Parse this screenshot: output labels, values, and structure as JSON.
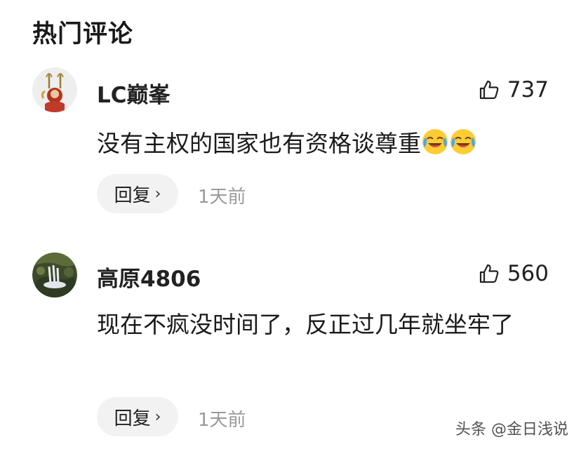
{
  "section": {
    "title": "热门评论"
  },
  "comments": [
    {
      "username": "LC巅峯",
      "likes": "737",
      "text": "没有主权的国家也有资格谈尊重",
      "emojis": [
        "laugh-cry-emoji",
        "laugh-cry-emoji"
      ],
      "reply_label": "回复",
      "time": "1天前"
    },
    {
      "username": "高原4806",
      "likes": "560",
      "text": "现在不疯没时间了，反正过几年就坐牢了",
      "reply_label": "回复",
      "time": "1天前"
    }
  ],
  "watermark": "头条 @金日浅说",
  "colors": {
    "secondary_text": "#9a9a9a",
    "reply_bg": "#f2f2f2"
  }
}
